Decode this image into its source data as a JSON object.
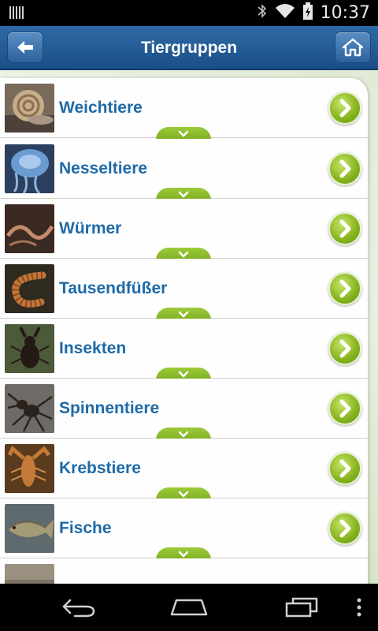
{
  "status_bar": {
    "time": "10:37",
    "icons": [
      "sim-card-icon",
      "bluetooth-icon",
      "wifi-icon",
      "battery-icon"
    ]
  },
  "action_bar": {
    "title": "Tiergruppen",
    "back_icon": "arrow-left-icon",
    "home_icon": "home-icon",
    "color": "#1f5a94"
  },
  "list": {
    "items": [
      {
        "label": "Weichtiere",
        "icon": "snail-thumbnail"
      },
      {
        "label": "Nesseltiere",
        "icon": "jellyfish-thumbnail"
      },
      {
        "label": "Würmer",
        "icon": "worm-thumbnail"
      },
      {
        "label": "Tausendfüßer",
        "icon": "millipede-thumbnail"
      },
      {
        "label": "Insekten",
        "icon": "stag-beetle-thumbnail"
      },
      {
        "label": "Spinnentiere",
        "icon": "spider-thumbnail"
      },
      {
        "label": "Krebstiere",
        "icon": "crayfish-thumbnail"
      },
      {
        "label": "Fische",
        "icon": "fish-thumbnail"
      },
      {
        "label": "",
        "icon": "partial-thumbnail"
      }
    ],
    "label_color": "#1e6aa8",
    "accent_green": "#8dbd25"
  },
  "nav_bar": {
    "icons": [
      "back-nav-icon",
      "home-nav-icon",
      "recent-apps-icon",
      "menu-overflow-icon"
    ]
  }
}
